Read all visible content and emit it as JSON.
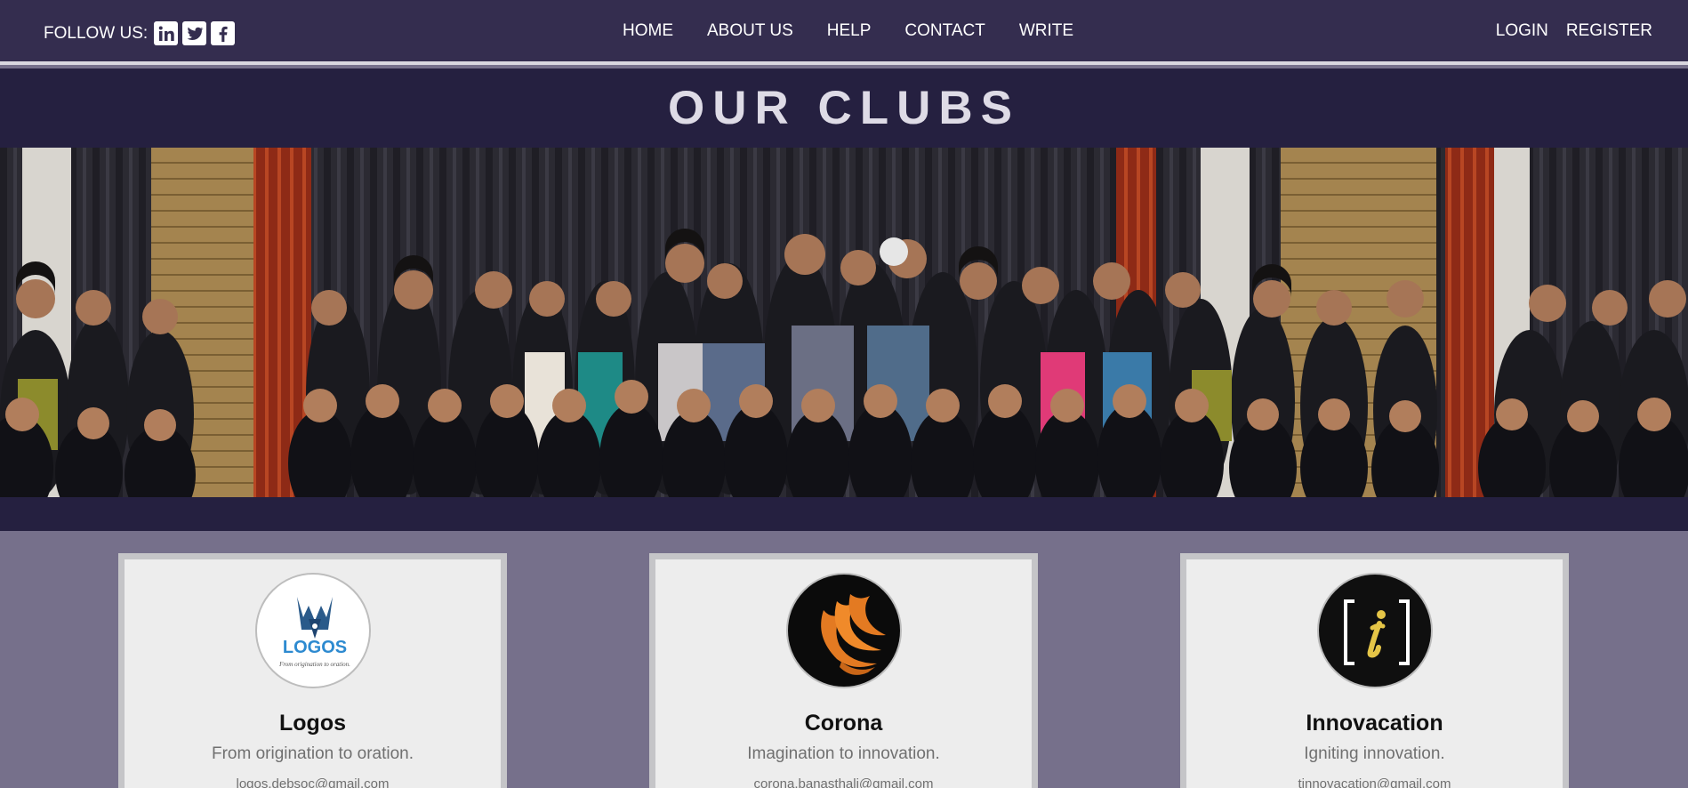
{
  "header": {
    "follow_label": "FOLLOW US:",
    "social": [
      {
        "name": "linkedin",
        "glyph": "in"
      },
      {
        "name": "twitter",
        "glyph": "t"
      },
      {
        "name": "facebook",
        "glyph": "f"
      }
    ],
    "nav": [
      "HOME",
      "ABOUT US",
      "HELP",
      "CONTACT",
      "WRITE"
    ],
    "auth": [
      "LOGIN",
      "REGISTER"
    ]
  },
  "page_title": "OUR CLUBS",
  "clubs": [
    {
      "name": "Logos",
      "tagline": "From origination to oration.",
      "email": "logos.debsoc@gmail.com",
      "logo_text": "LOGOS",
      "logo_sub": "From origination to oration.",
      "logo_icon": "pen-nib-icon"
    },
    {
      "name": "Corona",
      "tagline": "Imagination to innovation.",
      "email": "corona.banasthali@gmail.com",
      "logo_icon": "phoenix-icon"
    },
    {
      "name": "Innovacation",
      "tagline": "Igniting innovation.",
      "email": "tinnovacation@gmail.com",
      "logo_icon": "bracket-i-icon"
    }
  ],
  "colors": {
    "navbar": "#342d4f",
    "title_band": "#252040",
    "page_bg": "#76708b",
    "card_bg": "#ededed",
    "accent_orange": "#e37a22",
    "accent_yellow": "#e5c547"
  }
}
